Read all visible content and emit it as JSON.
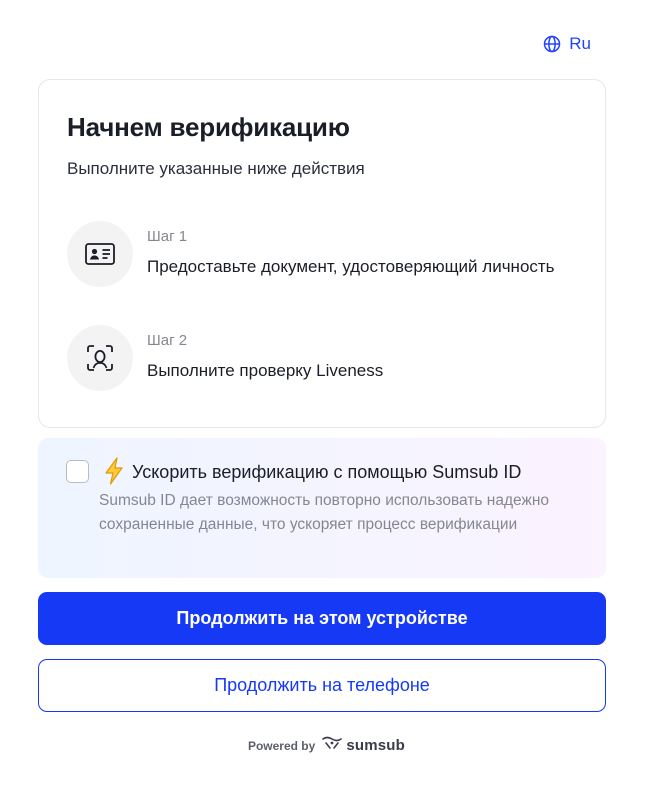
{
  "language": {
    "label": "Ru",
    "icon": "globe-icon"
  },
  "card": {
    "title": "Начнем верификацию",
    "subtitle": "Выполните указанные ниже действия",
    "steps": [
      {
        "label": "Шаг 1",
        "description": "Предоставьте документ, удостоверяющий личность",
        "icon": "id-card-icon"
      },
      {
        "label": "Шаг 2",
        "description": "Выполните проверку Liveness",
        "icon": "face-scan-icon"
      }
    ]
  },
  "promo": {
    "checked": false,
    "icon": "lightning-icon",
    "title": "Ускорить верификацию с помощью Sumsub ID",
    "description": "Sumsub ID дает возможность повторно использовать надежно сохраненные данные, что ускоряет процесс верификации"
  },
  "actions": {
    "primary_label": "Продолжить на этом устройстве",
    "secondary_label": "Продолжить на телефоне"
  },
  "footer": {
    "powered_label": "Powered by",
    "brand": "sumsub"
  },
  "colors": {
    "accent": "#1539f5",
    "text": "#1b1d29",
    "muted": "#848792"
  }
}
